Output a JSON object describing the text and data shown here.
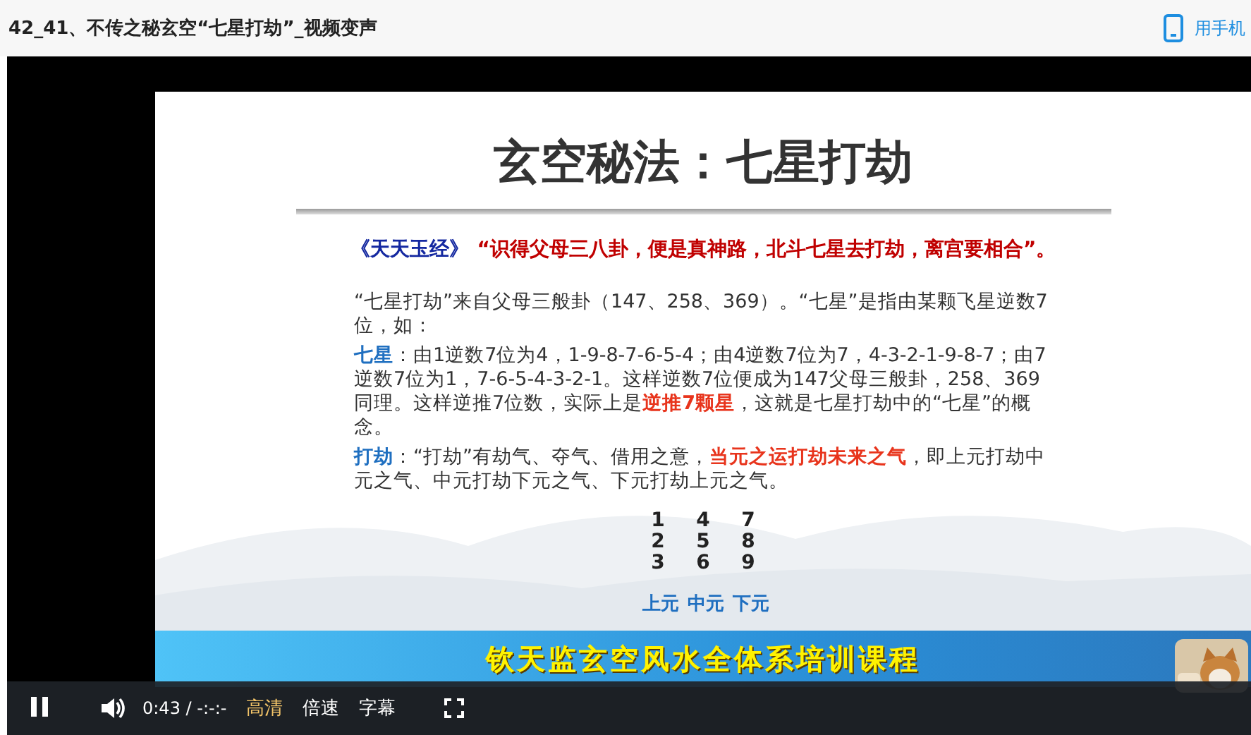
{
  "page": {
    "title": "42_41、不传之秘玄空“七星打劫”_视频变声",
    "mobile_link": "用手机"
  },
  "player": {
    "slide": {
      "title": "玄空秘法：七星打劫",
      "quote": {
        "source": "《天天玉经》",
        "text": "“识得父母三八卦，便是真神路，北斗七星去打劫，离宫要相合”。"
      },
      "paragraphs": [
        "“七星打劫”来自父母三般卦（147、258、369）。“七星”是指由某颗飞星逆数7位，如：",
        "**七星**：由1逆数7位为4，1-9-8-7-6-5-4；由4逆数7位为7，4-3-2-1-9-8-7；由7逆数7位为1，7-6-5-4-3-2-1。这样逆数7位便成为147父母三般卦，258、369同理。这样逆推7位数，实际上是**逆推7颗星**，这就是七星打劫中的“七星”的概念。",
        "**打劫**：“打劫”有劫气、夺气、借用之意，**当元之运打劫未来之气**，即上元打劫中元之气、中元打劫下元之气、下元打劫上元之气。"
      ],
      "grid": [
        [
          "1",
          "4",
          "7"
        ],
        [
          "2",
          "5",
          "8"
        ],
        [
          "3",
          "6",
          "9"
        ]
      ],
      "yuan": [
        "上元",
        "中元",
        "下元"
      ]
    },
    "banner": "钦天监玄空风水全体系培训课程",
    "controls": {
      "playing": true,
      "time": "0:43",
      "separator": "/",
      "duration": "-:-:-",
      "buttons": [
        {
          "label": "高清",
          "selected": true
        },
        {
          "label": "倍速",
          "selected": false
        },
        {
          "label": "字幕",
          "selected": false
        }
      ]
    }
  }
}
